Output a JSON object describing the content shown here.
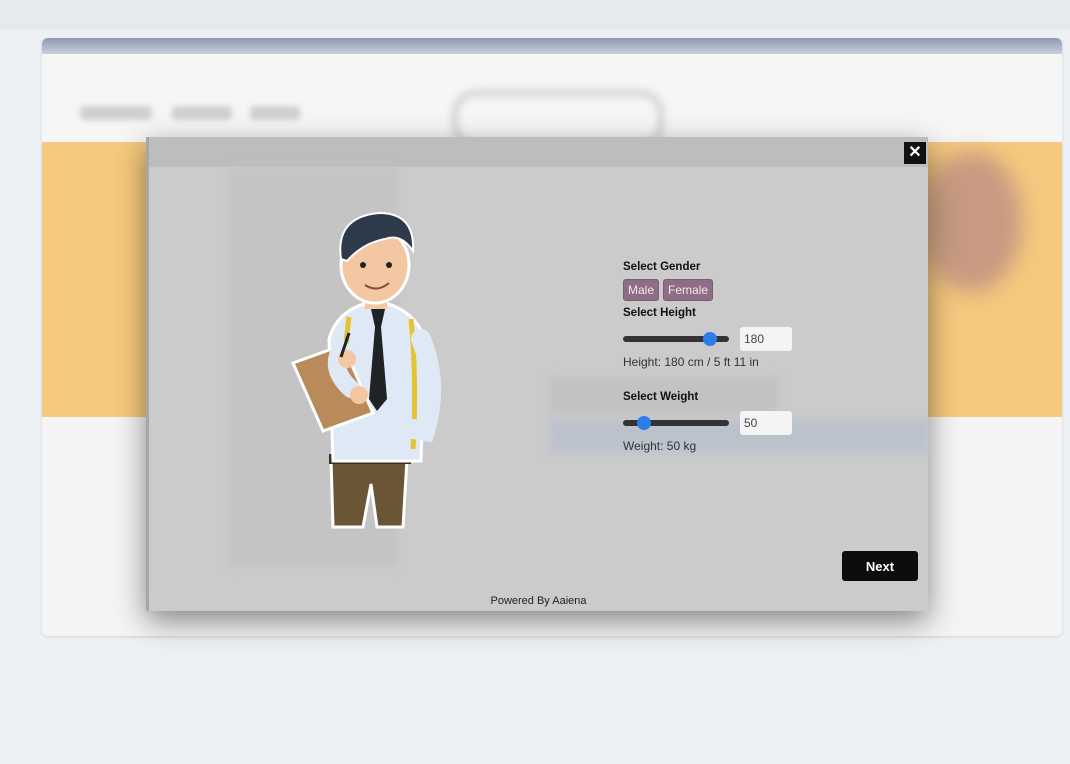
{
  "modal": {
    "close_glyph": "✕",
    "gender": {
      "title": "Select Gender",
      "options": [
        "Male",
        "Female"
      ]
    },
    "height": {
      "title": "Select Height",
      "value": "180",
      "slider_fraction": 0.82,
      "readout": "Height: 180 cm / 5 ft 11 in"
    },
    "weight": {
      "title": "Select Weight",
      "value": "50",
      "slider_fraction": 0.2,
      "readout": "Weight: 50 kg"
    },
    "next_label": "Next",
    "powered_by": "Powered By Aaiena"
  },
  "icons": {
    "close": "close-icon",
    "illustration": "tailor-man-illustration"
  },
  "colors": {
    "gender_button": "#8e6e86",
    "slider_thumb": "#2b7de9",
    "next_button": "#0d0d0d",
    "backdrop": "#cbcbcb"
  }
}
